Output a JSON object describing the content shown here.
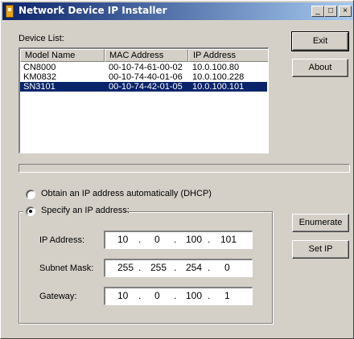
{
  "window": {
    "title": "Network Device IP Installer",
    "minimize_glyph": "_",
    "maximize_glyph": "□",
    "close_glyph": "×"
  },
  "device_list": {
    "label": "Device List:",
    "columns": [
      "Model Name",
      "MAC Address",
      "IP Address"
    ],
    "rows": [
      {
        "model": "CN8000",
        "mac": "00-10-74-61-00-02",
        "ip": "10.0.100.80",
        "selected": false
      },
      {
        "model": "KM0832",
        "mac": "00-10-74-40-01-06",
        "ip": "10.0.100.228",
        "selected": false
      },
      {
        "model": "SN3101",
        "mac": "00-10-74-42-01-05",
        "ip": "10.0.100.101",
        "selected": true
      }
    ]
  },
  "buttons": {
    "exit": "Exit",
    "about": "About",
    "enumerate": "Enumerate",
    "set_ip": "Set IP"
  },
  "progress": {
    "fraction": 0
  },
  "ip_mode": {
    "dhcp_label": "Obtain an IP address automatically (DHCP)",
    "static_label": "Specify an IP address:",
    "selected": "static"
  },
  "fields": {
    "ip_address": {
      "label": "IP Address:",
      "octets": [
        "10",
        "0",
        "100",
        "101"
      ]
    },
    "subnet_mask": {
      "label": "Subnet Mask:",
      "octets": [
        "255",
        "255",
        "254",
        "0"
      ]
    },
    "gateway": {
      "label": "Gateway:",
      "octets": [
        "10",
        "0",
        "100",
        "1"
      ]
    }
  },
  "separator": "."
}
